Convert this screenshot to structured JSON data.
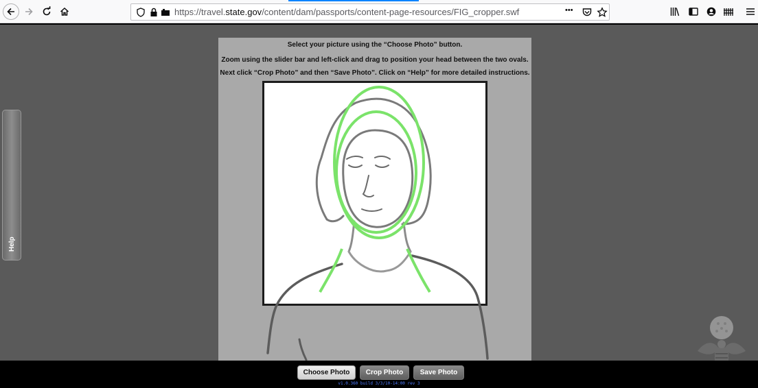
{
  "browser": {
    "url_prefix": "https://travel.",
    "url_domain": "state.gov",
    "url_suffix": "/content/dam/passports/content-page-resources/FIG_cropper.swf",
    "more_label": "•••"
  },
  "app": {
    "help_label": "Help",
    "instructions": [
      "Select your picture using the “Choose Photo” button.",
      "Zoom using the slider bar and left-click and drag to position your head between the two ovals.",
      "Next click “Crop Photo” and then “Save Photo”.  Click on “Help” for more detailed instructions."
    ],
    "buttons": {
      "choose": "Choose Photo",
      "crop": "Crop Photo",
      "save": "Save Photo"
    },
    "build_info": "v1.0.360 build 3/3/10-14:00 rev 3"
  },
  "colors": {
    "oval": "#7be36a",
    "sketch": "#7a7a7a",
    "frame": "#1c1c1c"
  }
}
